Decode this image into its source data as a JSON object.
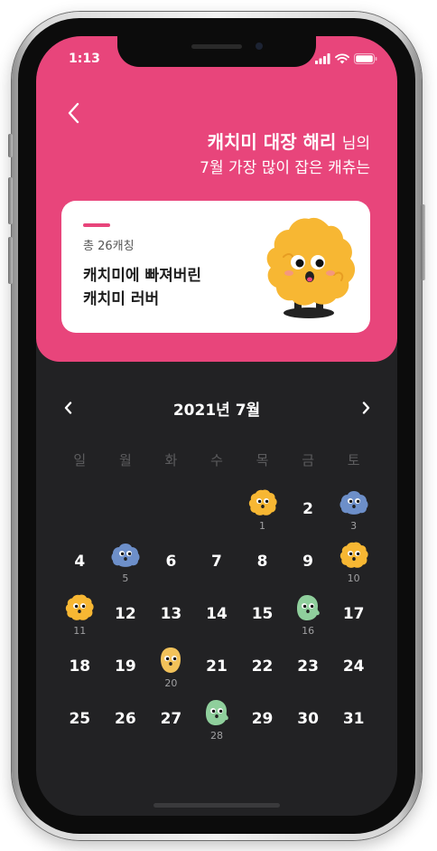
{
  "status": {
    "time": "1:13"
  },
  "header": {
    "name": "캐치미 대장 해리",
    "name_suffix": "님의",
    "subtitle": "7월 가장 많이 잡은 캐츄는"
  },
  "card": {
    "count_text": "총 26캐칭",
    "title_line1": "캐치미에 빠져버린",
    "title_line2": "캐치미 러버",
    "accent_color": "#e8457b"
  },
  "calendar": {
    "month_label": "2021년 7월",
    "weekdays": [
      "일",
      "월",
      "화",
      "수",
      "목",
      "금",
      "토"
    ],
    "weeks": [
      [
        {
          "day": "",
          "icon": null
        },
        {
          "day": "",
          "icon": null
        },
        {
          "day": "",
          "icon": null
        },
        {
          "day": "",
          "icon": null
        },
        {
          "day": "1",
          "icon": "orange"
        },
        {
          "day": "2",
          "icon": null
        },
        {
          "day": "3",
          "icon": "blue"
        }
      ],
      [
        {
          "day": "4",
          "icon": null
        },
        {
          "day": "5",
          "icon": "blue"
        },
        {
          "day": "6",
          "icon": null
        },
        {
          "day": "7",
          "icon": null
        },
        {
          "day": "8",
          "icon": null
        },
        {
          "day": "9",
          "icon": null
        },
        {
          "day": "10",
          "icon": "orange"
        }
      ],
      [
        {
          "day": "11",
          "icon": "orange"
        },
        {
          "day": "12",
          "icon": null
        },
        {
          "day": "13",
          "icon": null
        },
        {
          "day": "14",
          "icon": null
        },
        {
          "day": "15",
          "icon": null
        },
        {
          "day": "16",
          "icon": "green"
        },
        {
          "day": "17",
          "icon": null
        }
      ],
      [
        {
          "day": "18",
          "icon": null
        },
        {
          "day": "19",
          "icon": null
        },
        {
          "day": "20",
          "icon": "yellow"
        },
        {
          "day": "21",
          "icon": null
        },
        {
          "day": "22",
          "icon": null
        },
        {
          "day": "23",
          "icon": null
        },
        {
          "day": "24",
          "icon": null
        }
      ],
      [
        {
          "day": "25",
          "icon": null
        },
        {
          "day": "26",
          "icon": null
        },
        {
          "day": "27",
          "icon": null
        },
        {
          "day": "28",
          "icon": "green"
        },
        {
          "day": "29",
          "icon": null
        },
        {
          "day": "30",
          "icon": null
        },
        {
          "day": "31",
          "icon": null
        }
      ]
    ]
  },
  "colors": {
    "brand_pink": "#e8457b",
    "screen_bg": "#222224",
    "mascot_orange": "#f7b733",
    "mascot_blue": "#6d8fc9",
    "mascot_green": "#8fcf9c",
    "mascot_yellow": "#f2c25a"
  }
}
